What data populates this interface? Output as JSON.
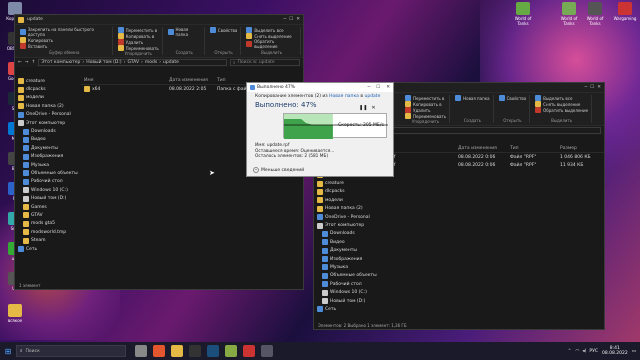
{
  "desktop_icons": [
    {
      "label": "Корзина",
      "color": "#7d8aa8"
    },
    {
      "label": "OBS Stu",
      "color": "#333"
    },
    {
      "label": "Google",
      "color": "#d44"
    },
    {
      "label": "Ste",
      "color": "#1b2838"
    },
    {
      "label": "Mic",
      "color": "#0078d4"
    },
    {
      "label": "Bla",
      "color": "#444"
    },
    {
      "label": "Ps",
      "color": "#2a62c9"
    },
    {
      "label": "Snip",
      "color": "#3aa"
    },
    {
      "label": "uTo",
      "color": "#3a3"
    },
    {
      "label": "UE",
      "color": "#555"
    },
    {
      "label": "всякое",
      "color": "#e5b945"
    }
  ],
  "right_icons": [
    {
      "label": "World of Tanks",
      "color": "#6a4"
    },
    {
      "label": "World of Tanks",
      "color": "#7a5"
    },
    {
      "label": "World of Tanks",
      "color": "#555"
    },
    {
      "label": "Wargaming",
      "color": "#c33"
    }
  ],
  "left_window": {
    "title": "update",
    "ribbon_groups": [
      {
        "label": "Буфер обмена",
        "items": [
          "Закрепить на панели быстрого доступа",
          "Копировать",
          "Вставить"
        ]
      },
      {
        "label": "Упорядочить",
        "items": [
          "Переместить в",
          "Копировать в",
          "Удалить",
          "Переименовать"
        ]
      },
      {
        "label": "Создать",
        "items": [
          "Новая папка"
        ]
      },
      {
        "label": "Открыть",
        "items": [
          "Свойства"
        ]
      },
      {
        "label": "Выделить",
        "items": [
          "Выделить все",
          "Снять выделение",
          "Обратить выделение"
        ]
      }
    ],
    "breadcrumb": [
      "Этот компьютер",
      "Новый том (D:)",
      "GTAV",
      "mods",
      "update"
    ],
    "search_placeholder": "Поиск в: update",
    "nav": [
      {
        "label": "creature",
        "indent": false,
        "icon": "y"
      },
      {
        "label": "dlcpacks",
        "indent": false,
        "icon": "y"
      },
      {
        "label": "модели",
        "indent": false,
        "icon": "y"
      },
      {
        "label": "Новая папка (2)",
        "indent": false,
        "icon": "y"
      },
      {
        "label": "OneDrive - Personal",
        "indent": false,
        "icon": "b"
      },
      {
        "label": "Этот компьютер",
        "indent": false,
        "icon": "w"
      },
      {
        "label": "Downloads",
        "indent": true,
        "icon": "b"
      },
      {
        "label": "Видео",
        "indent": true,
        "icon": "b"
      },
      {
        "label": "Документы",
        "indent": true,
        "icon": "b"
      },
      {
        "label": "Изображения",
        "indent": true,
        "icon": "b"
      },
      {
        "label": "Музыка",
        "indent": true,
        "icon": "b"
      },
      {
        "label": "Объемные объекты",
        "indent": true,
        "icon": "b"
      },
      {
        "label": "Рабочий стол",
        "indent": true,
        "icon": "b"
      },
      {
        "label": "Windows 10 (C:)",
        "indent": true,
        "icon": "w"
      },
      {
        "label": "Новый том (D:)",
        "indent": true,
        "icon": "w"
      },
      {
        "label": "Games",
        "indent": true,
        "icon": "y"
      },
      {
        "label": "GTAV",
        "indent": true,
        "icon": "y"
      },
      {
        "label": "mods gta5",
        "indent": true,
        "icon": "y"
      },
      {
        "label": "modsworld.tmp",
        "indent": true,
        "icon": "y"
      },
      {
        "label": "Steam",
        "indent": true,
        "icon": "y"
      },
      {
        "label": "Сеть",
        "indent": false,
        "icon": "b"
      }
    ],
    "columns": [
      "Имя",
      "Дата изменения",
      "Тип"
    ],
    "rows": [
      {
        "name": "x64",
        "date": "08.08.2022 2:05",
        "type": "Папка с файлами"
      }
    ],
    "status": "1 элемент"
  },
  "right_window": {
    "ribbon_groups": [
      {
        "label": "Упорядочить",
        "items": [
          "Переместить в",
          "Копировать в",
          "Удалить",
          "Переименовать"
        ]
      },
      {
        "label": "Создать",
        "items": [
          "Новая папка"
        ]
      },
      {
        "label": "Открыть",
        "items": [
          "Свойства"
        ]
      },
      {
        "label": "Выделить",
        "items": [
          "Выделить все",
          "Снять выделение",
          "Обратить выделение"
        ]
      }
    ],
    "nav": [
      {
        "label": "Изображения",
        "indent": false,
        "icon": "y"
      },
      {
        "label": "creature",
        "indent": false,
        "icon": "y"
      },
      {
        "label": "dlcpacks",
        "indent": false,
        "icon": "y"
      },
      {
        "label": "модели",
        "indent": false,
        "icon": "y"
      },
      {
        "label": "Новая папка (2)",
        "indent": false,
        "icon": "y"
      },
      {
        "label": "OneDrive - Personal",
        "indent": false,
        "icon": "b"
      },
      {
        "label": "Этот компьютер",
        "indent": false,
        "icon": "w"
      },
      {
        "label": "Downloads",
        "indent": true,
        "icon": "b"
      },
      {
        "label": "Видео",
        "indent": true,
        "icon": "b"
      },
      {
        "label": "Документы",
        "indent": true,
        "icon": "b"
      },
      {
        "label": "Изображения",
        "indent": true,
        "icon": "b"
      },
      {
        "label": "Музыка",
        "indent": true,
        "icon": "b"
      },
      {
        "label": "Объемные объекты",
        "indent": true,
        "icon": "b"
      },
      {
        "label": "Рабочий стол",
        "indent": true,
        "icon": "b"
      },
      {
        "label": "Windows 10 (C:)",
        "indent": true,
        "icon": "w"
      },
      {
        "label": "Новый том (D:)",
        "indent": true,
        "icon": "w"
      },
      {
        "label": "Сеть",
        "indent": false,
        "icon": "b"
      }
    ],
    "columns": [
      "Дата изменения",
      "Тип",
      "Размер"
    ],
    "rows": [
      {
        "name": "..pf",
        "date": "08.08.2022 0:06",
        "type": "Файл \"RPF\"",
        "size": "1 046 806 КБ"
      },
      {
        "name": "..pf",
        "date": "08.08.2022 0:06",
        "type": "Файл \"RPF\"",
        "size": "11 934 КБ"
      }
    ],
    "status": "Элементов: 2   Выбрано 1 элемент: 1,36 ГБ"
  },
  "dialog": {
    "title": "Выполнено 47%",
    "copy_line_prefix": "Копирование элементов (2) из",
    "src": "Новая папка",
    "mid": "в",
    "dst": "update",
    "progress_title": "Выполнено: 47%",
    "progress": 0.47,
    "speed": "Скорость: 205 МБ/с",
    "name_line": "Имя:  update.rpf",
    "remaining_time": "Оставшееся время:  Оценивается...",
    "remaining_items": "Осталось элементов: 2 (581 МБ)",
    "less_details": "Меньше сведений"
  },
  "taskbar": {
    "search_placeholder": "Поиск",
    "lang": "РУС",
    "time": "8:41",
    "date": "08.08.2022",
    "icons": [
      {
        "name": "task-view-icon",
        "color": "#888"
      },
      {
        "name": "chrome-icon",
        "color": "#e4572e"
      },
      {
        "name": "file-explorer-icon",
        "color": "#e5b945"
      },
      {
        "name": "obs-icon",
        "color": "#333"
      },
      {
        "name": "steam-icon",
        "color": "#1b4e7a"
      },
      {
        "name": "game-icon",
        "color": "#8a4"
      },
      {
        "name": "wot-icon",
        "color": "#c33"
      },
      {
        "name": "app-icon",
        "color": "#556"
      }
    ]
  }
}
